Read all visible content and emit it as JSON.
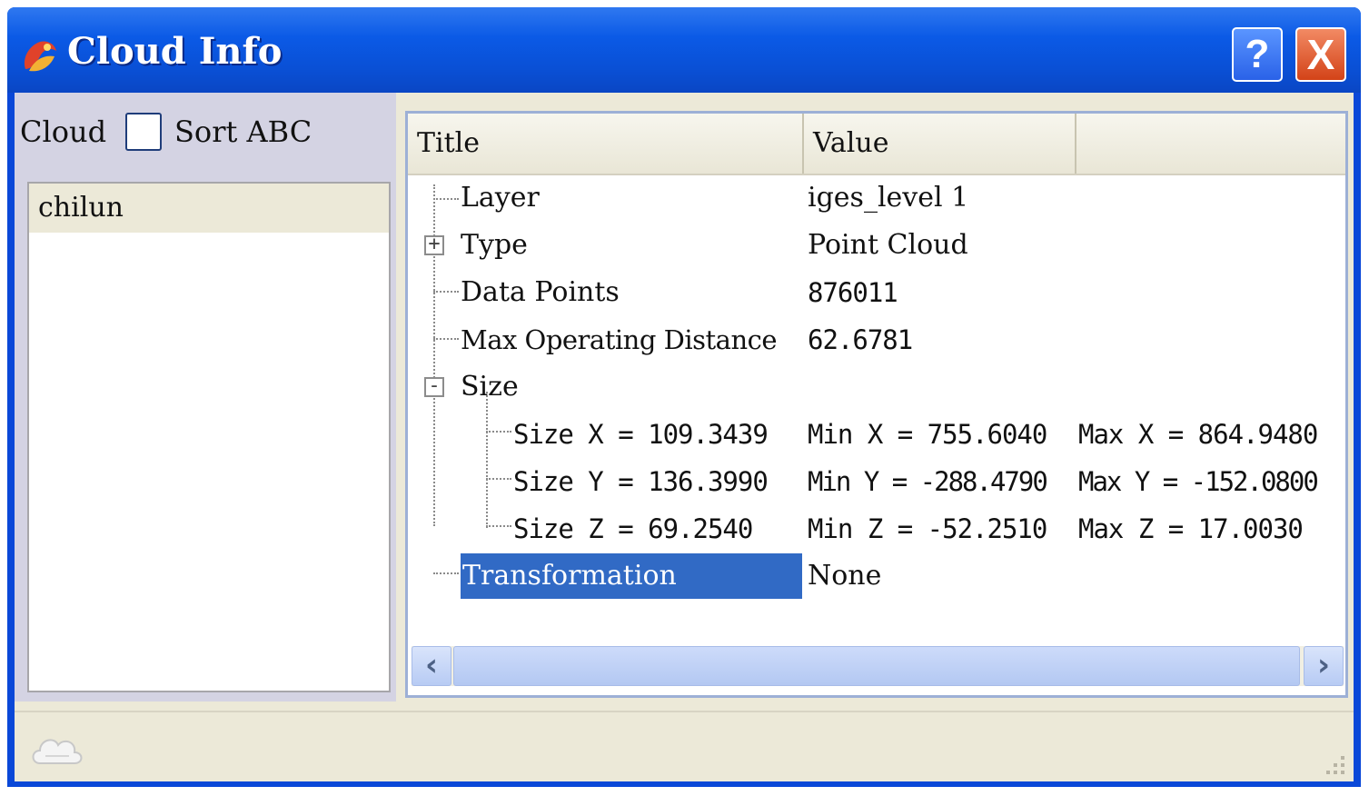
{
  "window": {
    "title": "Cloud Info",
    "help_label": "?",
    "close_label": "X"
  },
  "left_panel": {
    "cloud_label": "Cloud",
    "sort_label": "Sort ABC",
    "sort_checked": false,
    "items": [
      "chilun"
    ]
  },
  "tree": {
    "columns": [
      "Title",
      "Value"
    ],
    "rows": [
      {
        "title": "Layer",
        "value": "iges_level 1"
      },
      {
        "title": "Type",
        "value": "Point Cloud",
        "expander": "+"
      },
      {
        "title": "Data Points",
        "value": "876011"
      },
      {
        "title": "Max Operating Distance",
        "value": "62.6781"
      },
      {
        "title": "Size",
        "value": "",
        "expander": "-"
      },
      {
        "title": "Size X = 109.3439",
        "value": "Min X = 755.6040",
        "extra": "Max X = 864.9480"
      },
      {
        "title": "Size Y = 136.3990",
        "value": "Min Y = -288.4790",
        "extra": "Max Y = -152.0800"
      },
      {
        "title": "Size Z = 69.2540",
        "value": "Min Z = -52.2510",
        "extra": "Max Z = 17.0030"
      },
      {
        "title": "Transformation",
        "value": "None"
      }
    ],
    "selected_row": "Transformation"
  },
  "scrollbar": {
    "left_arrow": "‹",
    "right_arrow": "›"
  },
  "icons": {
    "app": "app-logo-icon",
    "status": "cloud-icon",
    "grip": "resize-grip-icon"
  }
}
